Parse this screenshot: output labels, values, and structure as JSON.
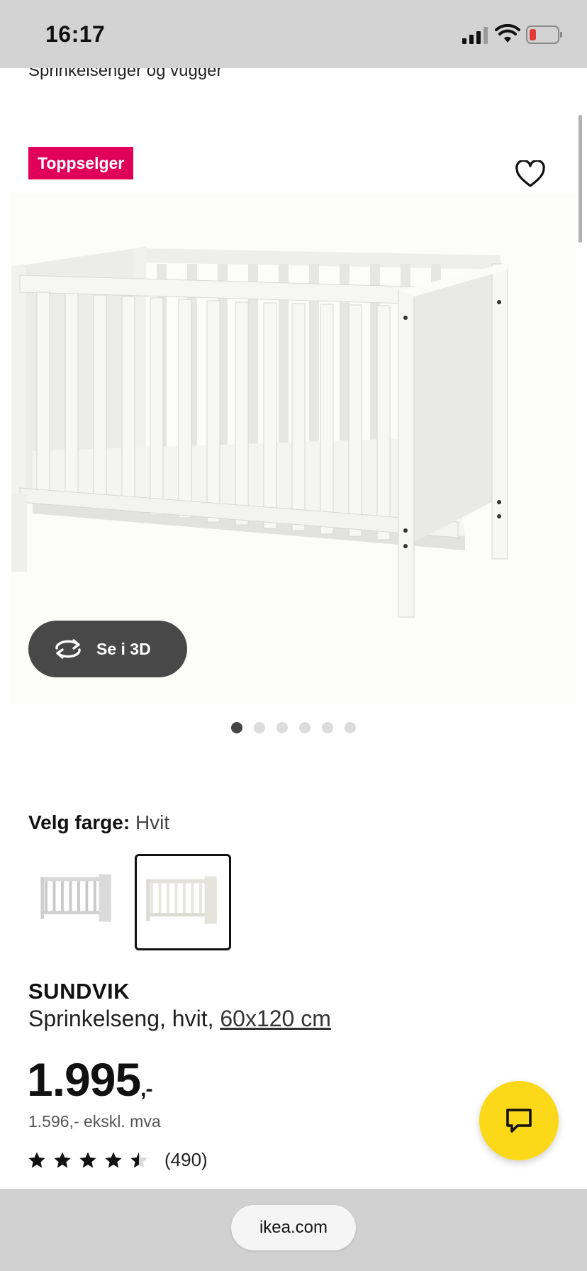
{
  "status": {
    "time": "16:17",
    "icons": [
      "cellular-signal-icon",
      "wifi-icon",
      "battery-low-icon"
    ],
    "battery_color": "#e53935"
  },
  "breadcrumb": "Sprinkelsenger og vugger",
  "product": {
    "badge": "Toppselger",
    "badge_color": "#e0005a",
    "view_3d_label": "Se i 3D",
    "carousel": {
      "count": 6,
      "active_index": 0
    },
    "color_label": "Velg farge:",
    "color_value": "Hvit",
    "swatches": [
      {
        "name": "Grå",
        "selected": false
      },
      {
        "name": "Hvit",
        "selected": true
      }
    ],
    "brand": "SUNDVIK",
    "description": "Sprinkelseng, hvit,",
    "size": "60x120 cm",
    "price_main": "1.995",
    "price_suffix": ",-",
    "price_ex_vat": "1.596,- ekskl. mva",
    "rating": 4.5,
    "reviews": "(490)"
  },
  "chat_button": {
    "icon": "chat-bubble-icon",
    "color": "#fcd918"
  },
  "browser": {
    "url": "ikea.com"
  }
}
